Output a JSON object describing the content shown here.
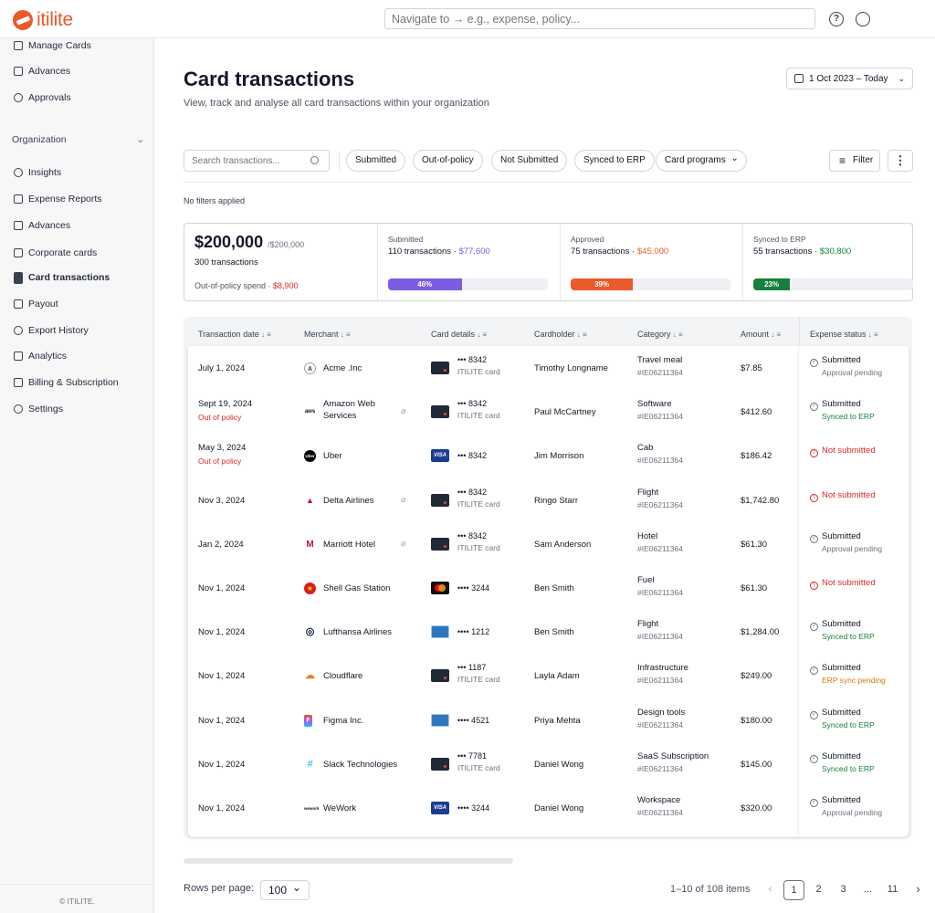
{
  "app": {
    "logo_text": "itilite",
    "nav_placeholder": "Navigate to → e.g., expense, policy...",
    "help_icon": "?"
  },
  "sidebar": {
    "items_top": [
      {
        "label": "Manage Cards",
        "icon": "card-icon"
      },
      {
        "label": "Advances",
        "icon": "advance-icon"
      },
      {
        "label": "Approvals",
        "icon": "check-circle-icon"
      }
    ],
    "group_label": "Organization",
    "items": [
      {
        "label": "Insights",
        "icon": "insights-icon"
      },
      {
        "label": "Expense Reports",
        "icon": "report-icon"
      },
      {
        "label": "Advances",
        "icon": "advance-icon"
      },
      {
        "label": "Corporate cards",
        "icon": "card-icon"
      },
      {
        "label": "Card transactions",
        "icon": "file-icon",
        "active": true
      },
      {
        "label": "Payout",
        "icon": "payout-icon"
      },
      {
        "label": "Export History",
        "icon": "history-icon"
      },
      {
        "label": "Analytics",
        "icon": "analytics-icon"
      },
      {
        "label": "Billing & Subscription",
        "icon": "billing-icon"
      },
      {
        "label": "Settings",
        "icon": "gear-icon"
      }
    ],
    "footer": "© ITILITE."
  },
  "header": {
    "title": "Card transactions",
    "subtitle": "View, track and analyse all card transactions within your organization",
    "date_range": "1 Oct 2023 – Today"
  },
  "toolbar": {
    "search_placeholder": "Search transactions...",
    "chips": [
      "Submitted",
      "Out-of-policy",
      "Not Submitted",
      "Synced to ERP",
      "Card programs"
    ],
    "filter_label": "Filter",
    "more_label": "⋮",
    "no_filters": "No filters applied"
  },
  "summary": {
    "total": "$200,000",
    "total_limit": "/$200,000",
    "count": "300 transactions",
    "oop_label": "Out-of-policy spend · ",
    "oop_value": "$8,900",
    "stats": [
      {
        "label": "Submitted",
        "tx": "110 transactions · ",
        "amount": "$77,600",
        "pct_label": "46%",
        "pct": 46,
        "color": "#7c5ce0"
      },
      {
        "label": "Approved",
        "tx": "75 transactions · ",
        "amount": "$45,000",
        "pct_label": "39%",
        "pct": 39,
        "color": "#ea5a2a"
      },
      {
        "label": "Synced to ERP",
        "tx": "55 transactions · ",
        "amount": "$30,800",
        "pct_label": "23%",
        "pct": 23,
        "color": "#15803d"
      }
    ]
  },
  "table": {
    "columns": [
      "Transaction date",
      "Merchant",
      "Card details",
      "Cardholder",
      "Category",
      "Amount",
      "Expense status"
    ],
    "rows": [
      {
        "date": "July 1, 2024",
        "note": "",
        "merchant": "Acme .Inc",
        "merchant2": "",
        "icon": "A",
        "clip": false,
        "card": "dark",
        "digits": "••• 8342",
        "program": "ITILITE card",
        "holder": "Timothy Longname",
        "cat": "Travel meal",
        "code": "#IE06211364",
        "amount": "$7.85",
        "status": "Submitted",
        "sub": "Approval pending",
        "subtype": "gray",
        "err": false
      },
      {
        "date": "Sept 19, 2024",
        "note": "Out of policy",
        "merchant": "Amazon Web",
        "merchant2": "Services",
        "icon": "aws",
        "clip": true,
        "card": "dark",
        "digits": "••• 8342",
        "program": "ITILITE card",
        "holder": "Paul McCartney",
        "cat": "Software",
        "code": "#IE06211364",
        "amount": "$412.60",
        "status": "Submitted",
        "sub": "Synced to ERP",
        "subtype": "green",
        "err": false
      },
      {
        "date": "May 3, 2024",
        "note": "Out of policy",
        "merchant": "Uber",
        "merchant2": "",
        "icon": "Uber",
        "clip": false,
        "card": "visa",
        "digits": "••• 8342",
        "program": "",
        "holder": "Jim Morrison",
        "cat": "Cab",
        "code": "#IE06211364",
        "amount": "$186.42",
        "status": "Not submitted",
        "sub": "",
        "subtype": "",
        "err": true
      },
      {
        "date": "Nov 3, 2024",
        "note": "",
        "merchant": "Delta Airlines",
        "merchant2": "",
        "icon": "▲",
        "clip": true,
        "card": "dark",
        "digits": "••• 8342",
        "program": "ITILITE card",
        "holder": "Ringo Starr",
        "cat": "Flight",
        "code": "#IE06211364",
        "amount": "$1,742.80",
        "status": "Not submitted",
        "sub": "",
        "subtype": "",
        "err": true
      },
      {
        "date": "Jan 2, 2024",
        "note": "",
        "merchant": "Marriott Hotel",
        "merchant2": "",
        "icon": "M",
        "clip": true,
        "card": "dark",
        "digits": "••• 8342",
        "program": "ITILITE card",
        "holder": "Sam Anderson",
        "cat": "Hotel",
        "code": "#IE06211364",
        "amount": "$61.30",
        "status": "Submitted",
        "sub": "Approval pending",
        "subtype": "gray",
        "err": false
      },
      {
        "date": "Nov 1, 2024",
        "note": "",
        "merchant": "Shell Gas Station",
        "merchant2": "",
        "icon": "●",
        "clip": false,
        "card": "mc",
        "digits": "•••• 3244",
        "program": "",
        "holder": "Ben Smith",
        "cat": "Fuel",
        "code": "#IE06211364",
        "amount": "$61.30",
        "status": "Not submitted",
        "sub": "",
        "subtype": "",
        "err": true
      },
      {
        "date": "Nov 1, 2024",
        "note": "",
        "merchant": "Lufthansa Airlines",
        "merchant2": "",
        "icon": "◎",
        "clip": false,
        "card": "amex",
        "digits": "•••• 1212",
        "program": "",
        "holder": "Ben Smith",
        "cat": "Flight",
        "code": "#IE06211364",
        "amount": "$1,284.00",
        "status": "Submitted",
        "sub": "Synced to ERP",
        "subtype": "green",
        "err": false
      },
      {
        "date": "Nov 1, 2024",
        "note": "",
        "merchant": "Cloudflare",
        "merchant2": "",
        "icon": "☁",
        "clip": false,
        "card": "dark",
        "digits": "••• 1187",
        "program": "ITILITE card",
        "holder": "Layla Adam",
        "cat": "Infrastructure",
        "code": "#IE06211364",
        "amount": "$249.00",
        "status": "Submitted",
        "sub": "ERP sync pending",
        "subtype": "amber",
        "err": false
      },
      {
        "date": "Nov 1, 2024",
        "note": "",
        "merchant": "Figma Inc.",
        "merchant2": "",
        "icon": "F",
        "clip": false,
        "card": "amex",
        "digits": "•••• 4521",
        "program": "",
        "holder": "Priya Mehta",
        "cat": "Design tools",
        "code": "#IE06211364",
        "amount": "$180.00",
        "status": "Submitted",
        "sub": "Synced to ERP",
        "subtype": "green",
        "err": false
      },
      {
        "date": "Nov 1, 2024",
        "note": "",
        "merchant": "Slack Technologies",
        "merchant2": "",
        "icon": "#",
        "clip": false,
        "card": "dark",
        "digits": "••• 7781",
        "program": "ITILITE card",
        "holder": "Daniel Wong",
        "cat": "SaaS Subscription",
        "code": "#IE06211364",
        "amount": "$145.00",
        "status": "Submitted",
        "sub": "Synced to ERP",
        "subtype": "green",
        "err": false
      },
      {
        "date": "Nov 1, 2024",
        "note": "",
        "merchant": "WeWork",
        "merchant2": "",
        "icon": "wework",
        "clip": false,
        "card": "visa",
        "digits": "•••• 3244",
        "program": "",
        "holder": "Daniel Wong",
        "cat": "Workspace",
        "code": "#IE06211364",
        "amount": "$320.00",
        "status": "Submitted",
        "sub": "Approval pending",
        "subtype": "gray",
        "err": false
      }
    ]
  },
  "pagination": {
    "rows_label": "Rows per page:",
    "rows_value": "100",
    "range": "1–10 of 108 items",
    "pages": [
      "1",
      "2",
      "3",
      "...",
      "11"
    ],
    "prev": "‹",
    "next": "›"
  },
  "card_brand": {
    "visa": "VISA"
  }
}
